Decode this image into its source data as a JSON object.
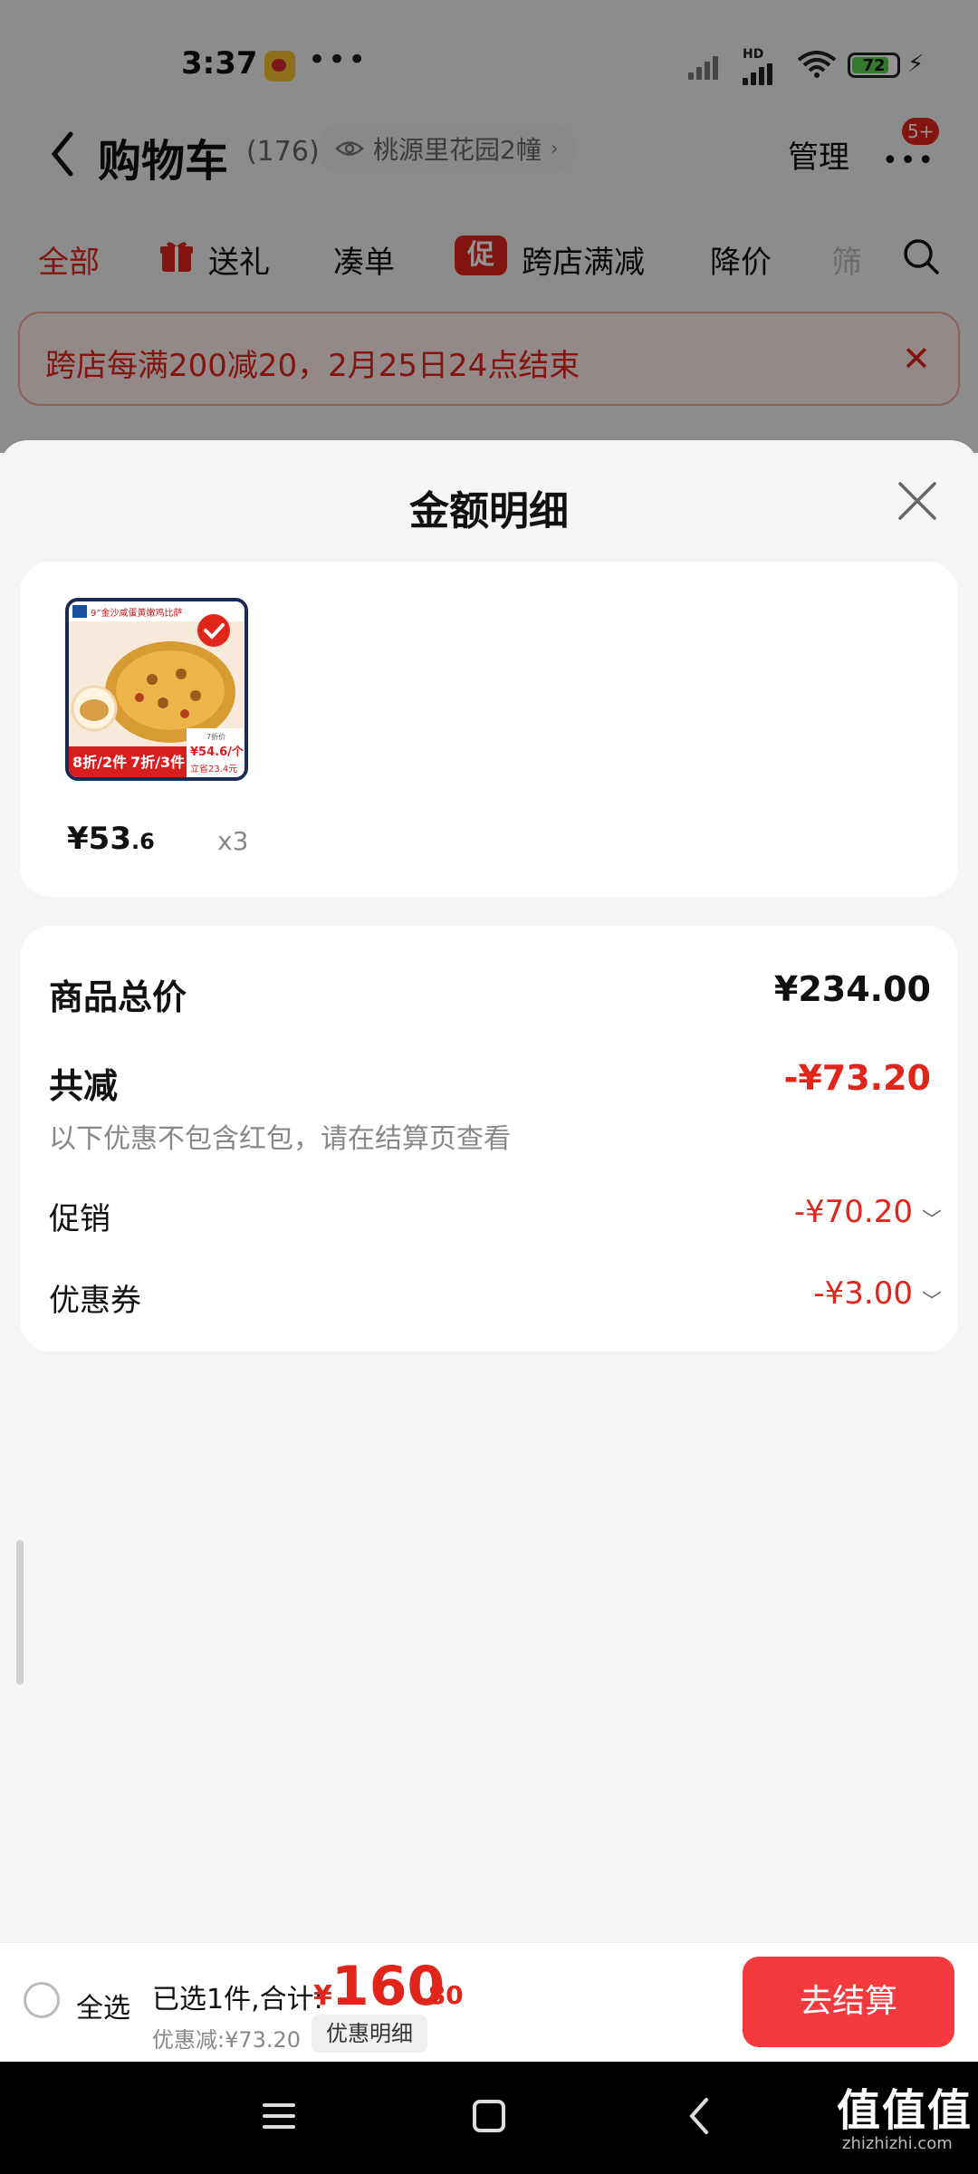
{
  "status_bar": {
    "time": "3:37",
    "more": "•••",
    "network_label": "HD",
    "battery_level": "72"
  },
  "header": {
    "title": "购物车",
    "count": "(176)",
    "address": "桃源里花园2幢",
    "manage_label": "管理",
    "more_icon": "more-dots-icon",
    "badge": "5+"
  },
  "tabs": [
    {
      "label": "全部",
      "active": true
    },
    {
      "label": "送礼",
      "icon": "gift-icon"
    },
    {
      "label": "凑单"
    },
    {
      "label": "跨店满减",
      "tag": "促"
    },
    {
      "label": "降价"
    },
    {
      "label": "筛"
    }
  ],
  "promo_banner": {
    "text": "跨店每满200减20，2月25日24点结束"
  },
  "sheet": {
    "title": "金额明细",
    "product": {
      "image_texts": {
        "headline": "9”金沙咸蛋黄嫩鸡比萨",
        "discount_2": "8折/2件",
        "discount_3": "7折/3件",
        "price_tag_label": "7折价",
        "price_tag_value": "¥54.6/个",
        "price_tag_save": "立省23.4元"
      },
      "price_symbol": "¥",
      "price_int": "53",
      "price_dec": ".6",
      "quantity": "x3"
    },
    "summary": {
      "total_label": "商品总价",
      "total_value": "¥234.00",
      "reduce_label": "共减",
      "reduce_value": "-¥73.20",
      "note": "以下优惠不包含红包，请在结算页查看",
      "promo_label": "促销",
      "promo_value": "-¥70.20",
      "coupon_label": "优惠券",
      "coupon_value": "-¥3.00"
    }
  },
  "bottom_bar": {
    "select_all": "全选",
    "selected_text": "已选1件,合计:",
    "total_symbol": "¥",
    "total_int": "160",
    "total_dec": ".80",
    "discount_text": "优惠减:¥73.20",
    "detail_button": "优惠明细",
    "checkout": "去结算"
  },
  "watermark": {
    "logo": "值值值",
    "url": "zhizhizhi.com"
  },
  "colors": {
    "accent": "#e1251b",
    "checkout": "#f43a3f"
  }
}
